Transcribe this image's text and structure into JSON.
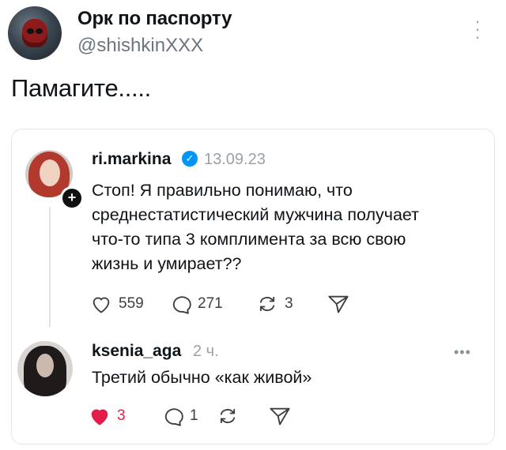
{
  "post": {
    "author_name": "Орк по паспорту",
    "author_handle": "@shishkinXXX",
    "text": "Памагите....."
  },
  "thread": {
    "first": {
      "username": "ri.markina",
      "date": "13.09.23",
      "lines": [
        "Стоп! Я правильно понимаю, что",
        "среднестатистический мужчина получает",
        "что-то типа 3 комплимента за всю свою",
        "жизнь и умирает??"
      ],
      "likes": "559",
      "comments": "271",
      "reposts": "3"
    },
    "reply": {
      "username": "ksenia_aga",
      "time": "2 ч.",
      "text": "Третий обычно «как живой»",
      "likes": "3",
      "comments": "1"
    }
  },
  "colors": {
    "text": "#0f1419",
    "muted": "#9aa1a8",
    "verified": "#0095f6",
    "liked": "#e11d48",
    "border": "#e4e6e8"
  }
}
